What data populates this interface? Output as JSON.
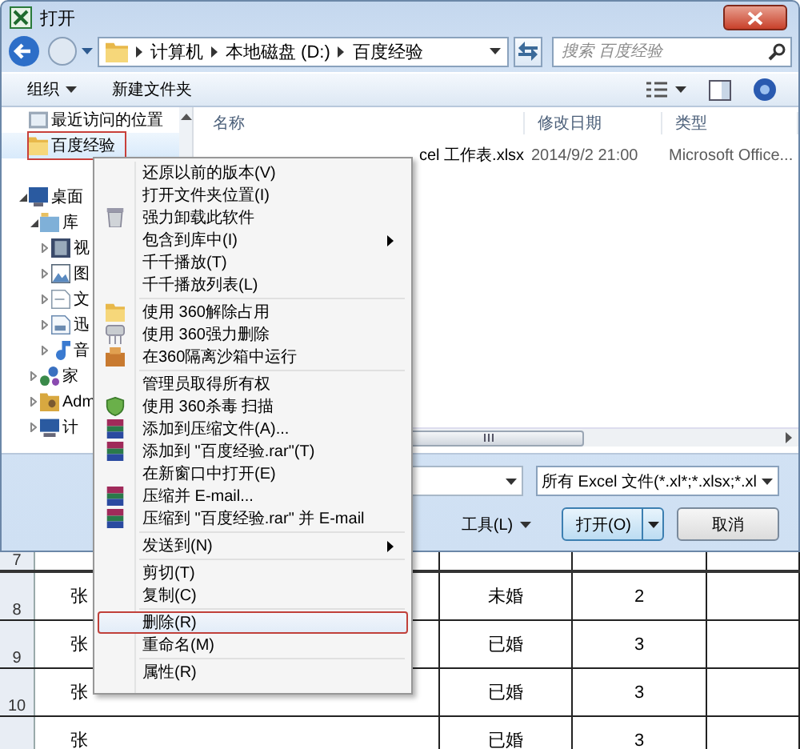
{
  "window": {
    "title": "打开"
  },
  "address": {
    "crumbs": [
      "计算机",
      "本地磁盘 (D:)",
      "百度经验"
    ]
  },
  "search": {
    "placeholder": "搜索 百度经验"
  },
  "toolbar": {
    "buttons": [
      {
        "label": "组织",
        "dropdown": true
      },
      {
        "label": "新建文件夹",
        "dropdown": false
      }
    ]
  },
  "nav": {
    "items": [
      {
        "label": "最近访问的位置",
        "selected": false
      },
      {
        "label": "百度经验",
        "selected": true
      },
      {
        "label": "桌面",
        "selected": false,
        "expanded": true,
        "children": [
          {
            "label": "库",
            "expanded": true,
            "children": [
              {
                "label": "视",
                "expanded": false
              },
              {
                "label": "图",
                "expanded": false
              },
              {
                "label": "文",
                "expanded": false
              },
              {
                "label": "迅",
                "expanded": false
              },
              {
                "label": "音",
                "expanded": false
              }
            ]
          },
          {
            "label": "家",
            "expanded": false
          },
          {
            "label": "Adm",
            "expanded": false
          },
          {
            "label": "计",
            "expanded": false
          }
        ]
      }
    ]
  },
  "files": {
    "columns": [
      "名称",
      "修改日期",
      "类型"
    ],
    "rows": [
      {
        "name": "cel 工作表.xlsx",
        "date": "2014/9/2 21:00",
        "type": "Microsoft Office..."
      }
    ]
  },
  "file_type": {
    "value": "所有 Excel 文件(*.xl*;*.xlsx;*.xl"
  },
  "buttons": [
    {
      "label": "工具(L)",
      "kind": "menu"
    },
    {
      "label": "打开(O)",
      "kind": "split"
    },
    {
      "label": "取消",
      "kind": "plain"
    }
  ],
  "context_menu": {
    "items": [
      {
        "kind": "item",
        "label": "还原以前的版本(V)",
        "submenu": false,
        "selected": false
      },
      {
        "kind": "item",
        "label": "打开文件夹位置(I)",
        "submenu": false,
        "selected": false
      },
      {
        "kind": "item",
        "label": "强力卸载此软件",
        "submenu": false,
        "selected": false
      },
      {
        "kind": "item",
        "label": "包含到库中(I)",
        "submenu": true,
        "selected": false
      },
      {
        "kind": "item",
        "label": "千千播放(T)",
        "submenu": false,
        "selected": false
      },
      {
        "kind": "item",
        "label": "千千播放列表(L)",
        "submenu": false,
        "selected": false
      },
      {
        "kind": "separator"
      },
      {
        "kind": "item",
        "label": "使用 360解除占用",
        "submenu": false,
        "selected": false
      },
      {
        "kind": "item",
        "label": "使用 360强力删除",
        "submenu": false,
        "selected": false
      },
      {
        "kind": "item",
        "label": "在360隔离沙箱中运行",
        "submenu": false,
        "selected": false
      },
      {
        "kind": "separator"
      },
      {
        "kind": "item",
        "label": "管理员取得所有权",
        "submenu": false,
        "selected": false
      },
      {
        "kind": "item",
        "label": "使用 360杀毒 扫描",
        "submenu": false,
        "selected": false
      },
      {
        "kind": "item",
        "label": "添加到压缩文件(A)...",
        "submenu": false,
        "selected": false
      },
      {
        "kind": "item",
        "label": "添加到 \"百度经验.rar\"(T)",
        "submenu": false,
        "selected": false
      },
      {
        "kind": "item",
        "label": "在新窗口中打开(E)",
        "submenu": false,
        "selected": false
      },
      {
        "kind": "item",
        "label": "压缩并 E-mail...",
        "submenu": false,
        "selected": false
      },
      {
        "kind": "item",
        "label": "压缩到 \"百度经验.rar\" 并 E-mail",
        "submenu": false,
        "selected": false
      },
      {
        "kind": "separator"
      },
      {
        "kind": "item",
        "label": "发送到(N)",
        "submenu": true,
        "selected": false
      },
      {
        "kind": "separator"
      },
      {
        "kind": "item",
        "label": "剪切(T)",
        "submenu": false,
        "selected": false
      },
      {
        "kind": "item",
        "label": "复制(C)",
        "submenu": false,
        "selected": false
      },
      {
        "kind": "separator"
      },
      {
        "kind": "item",
        "label": "删除(R)",
        "submenu": false,
        "selected": true
      },
      {
        "kind": "item",
        "label": "重命名(M)",
        "submenu": false,
        "selected": false
      },
      {
        "kind": "separator"
      },
      {
        "kind": "item",
        "label": "属性(R)",
        "submenu": false,
        "selected": false
      }
    ]
  },
  "sheet": {
    "rows": [
      {
        "header": "7",
        "cells": []
      },
      {
        "header": "8",
        "cells": [
          "张",
          "未婚",
          "2",
          ""
        ]
      },
      {
        "header": "9",
        "cells": [
          "张",
          "已婚",
          "3",
          ""
        ]
      },
      {
        "header": "10",
        "cells": [
          "张",
          "已婚",
          "3",
          ""
        ]
      },
      {
        "cells": [
          "张",
          "已婚",
          "3",
          ""
        ]
      }
    ]
  }
}
